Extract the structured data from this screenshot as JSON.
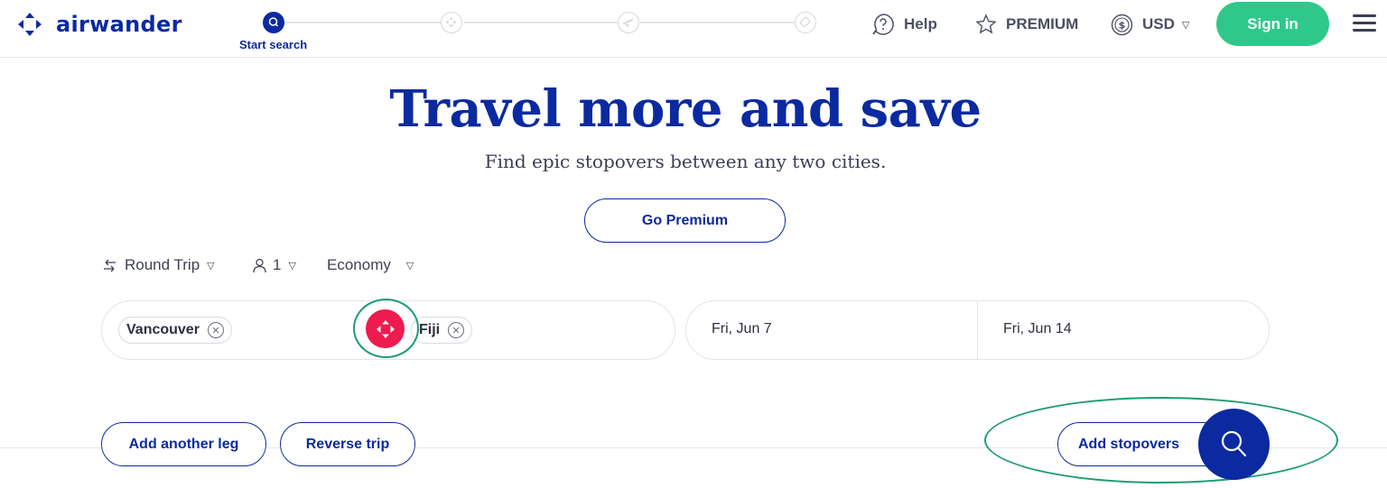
{
  "brand": {
    "name": "airwander",
    "color": "#0b2aa0"
  },
  "stepper": {
    "active_label": "Start search",
    "steps": [
      "search-icon",
      "stopover-icon",
      "flight-icon",
      "ticket-icon"
    ]
  },
  "nav": {
    "help": "Help",
    "premium": "PREMIUM",
    "currency": "USD",
    "signin": "Sign in"
  },
  "hero": {
    "title": "Travel more and save",
    "subtitle": "Find epic stopovers between any two cities.",
    "premium_button": "Go Premium"
  },
  "options": {
    "trip_type": "Round Trip",
    "passengers": "1",
    "cabin": "Economy"
  },
  "search": {
    "origin": "Vancouver",
    "destination": "Fiji",
    "depart_date": "Fri, Jun 7",
    "return_date": "Fri, Jun 14"
  },
  "actions": {
    "add_leg": "Add another leg",
    "reverse": "Reverse trip",
    "add_stopovers": "Add stopovers"
  },
  "colors": {
    "accent": "#0b2aa0",
    "signin": "#2fc88a",
    "swap": "#ee1b4e",
    "highlight": "#1e9b77"
  }
}
